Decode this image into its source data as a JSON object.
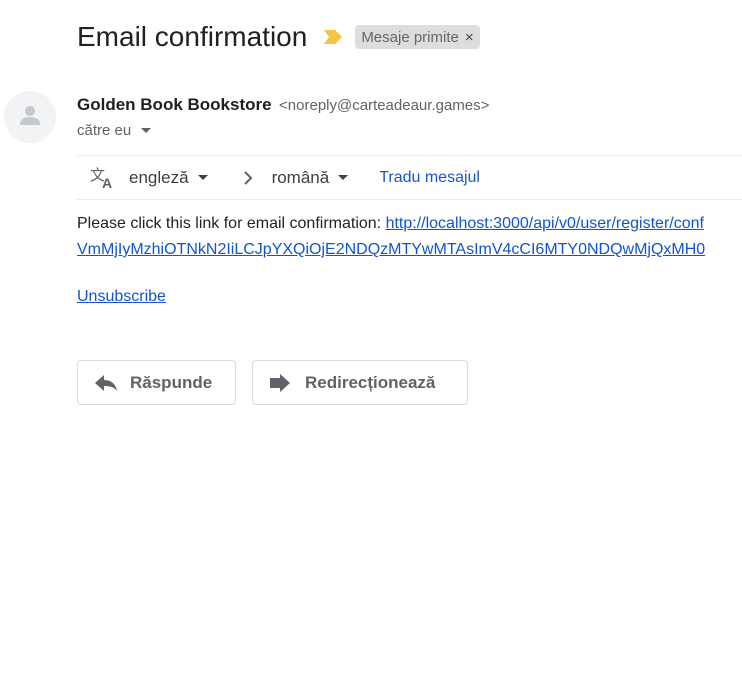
{
  "email": {
    "subject": "Email confirmation",
    "label": "Mesaje primite",
    "label_remove": "×",
    "sender_name": "Golden Book Bookstore",
    "sender_email": "<noreply@carteadeaur.games>",
    "recipient": "către eu"
  },
  "translate": {
    "from_lang": "engleză",
    "to_lang": "română",
    "action": "Tradu mesajul"
  },
  "body": {
    "intro": "Please click this link for email confirmation: ",
    "link_line1": "http://localhost:3000/api/v0/user/register/conf",
    "link_line2": "VmMjIyMzhiOTNkN2IiLCJpYXQiOjE2NDQzMTYwMTAsImV4cCI6MTY0NDQwMjQxMH0",
    "unsubscribe": "Unsubscribe"
  },
  "actions": {
    "reply": "Răspunde",
    "forward": "Redirecționează"
  },
  "colors": {
    "importance": "#f4c542",
    "link": "#1155cc",
    "translate_link": "#1a57c9"
  },
  "icons": {
    "importance": "importance-marker-icon",
    "avatar": "person-icon",
    "translate": "translate-icon",
    "reply": "reply-icon",
    "forward": "forward-icon"
  }
}
